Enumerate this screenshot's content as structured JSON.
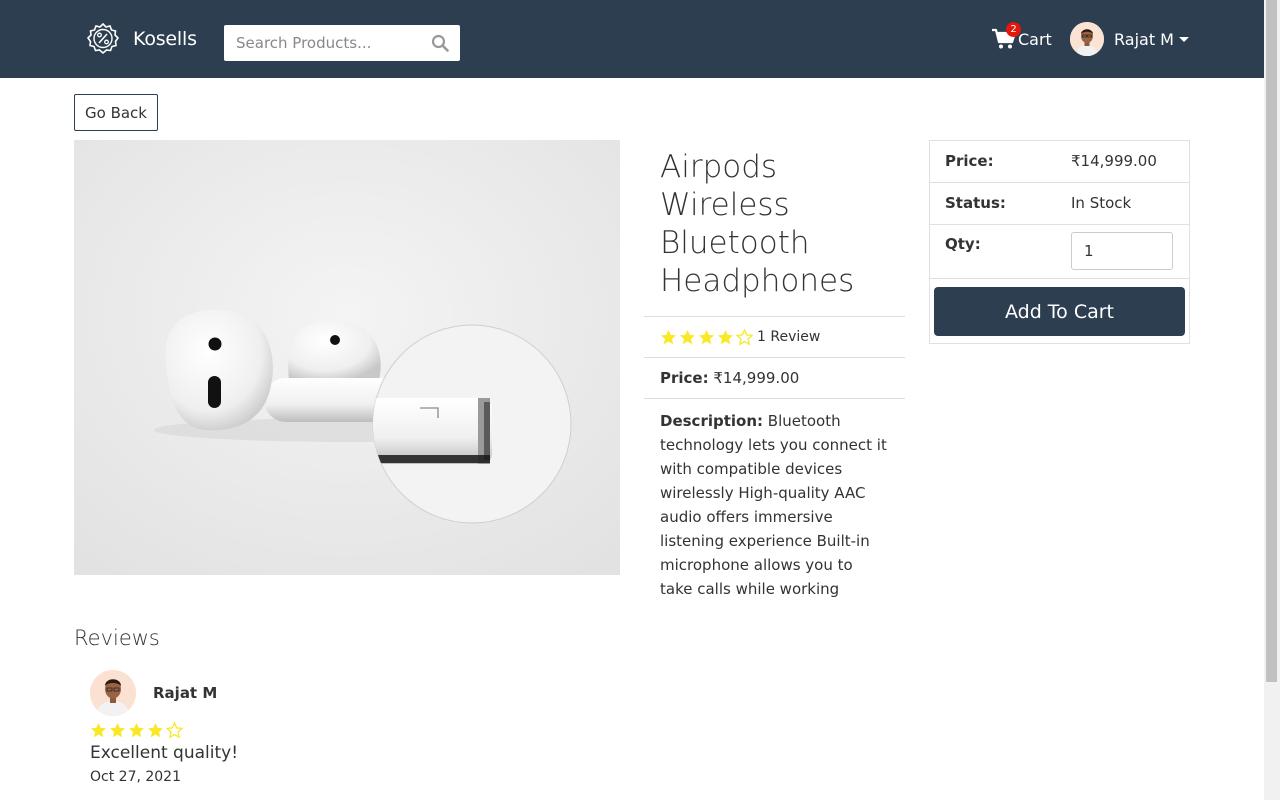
{
  "header": {
    "brand": "Kosells",
    "search_placeholder": "Search Products...",
    "cart_label": "Cart",
    "cart_count": "2",
    "user_name": "Rajat M"
  },
  "actions": {
    "go_back": "Go Back"
  },
  "product": {
    "title": "Airpods Wireless Bluetooth Headphones",
    "rating": 4,
    "review_count_label": "1 Review",
    "price_label": "Price:",
    "price": "₹14,999.00",
    "description_label": "Description:",
    "description": "Bluetooth technology lets you connect it with compatible devices wirelessly High-quality AAC audio offers immersive listening experience Built-in microphone allows you to take calls while working"
  },
  "purchase": {
    "price_label": "Price:",
    "price": "₹14,999.00",
    "status_label": "Status:",
    "status": "In Stock",
    "qty_label": "Qty:",
    "qty_value": "1",
    "add_to_cart": "Add To Cart"
  },
  "reviews": {
    "heading": "Reviews",
    "items": [
      {
        "name": "Rajat M",
        "rating": 4,
        "comment": "Excellent quality!",
        "date": "Oct 27, 2021"
      }
    ]
  },
  "colors": {
    "navbar": "#2c3e50",
    "star": "#f8e825",
    "badge": "#e3170a"
  }
}
